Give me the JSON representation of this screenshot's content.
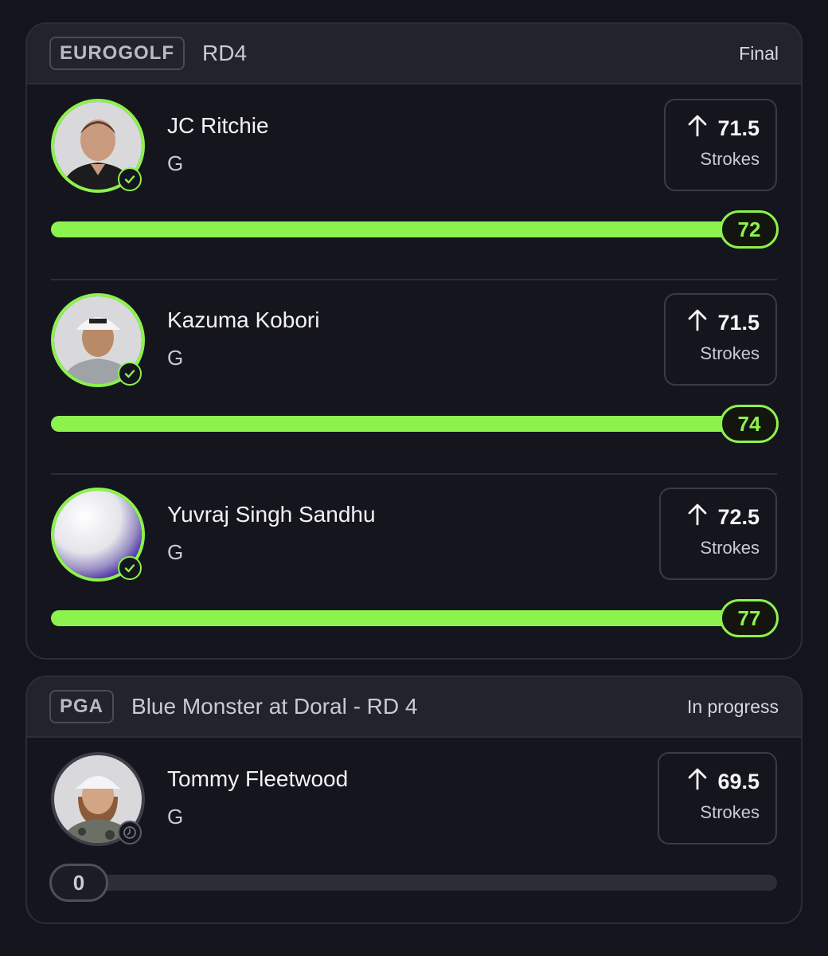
{
  "colors": {
    "accent": "#8cf24d",
    "background": "#14141c",
    "card": "#15151d"
  },
  "cards": [
    {
      "league": "EUROGOLF",
      "event": "RD4",
      "status": "Final",
      "players": [
        {
          "name": "JC Ritchie",
          "position": "G",
          "line": "71.5",
          "line_label": "Strokes",
          "direction": "up-arrow-icon",
          "score": "72",
          "progress": 1.0
        },
        {
          "name": "Kazuma Kobori",
          "position": "G",
          "line": "71.5",
          "line_label": "Strokes",
          "direction": "up-arrow-icon",
          "score": "74",
          "progress": 1.0
        },
        {
          "name": "Yuvraj Singh Sandhu",
          "position": "G",
          "line": "72.5",
          "line_label": "Strokes",
          "direction": "up-arrow-icon",
          "score": "77",
          "progress": 1.0
        }
      ]
    },
    {
      "league": "PGA",
      "event": "Blue Monster at Doral - RD 4",
      "status": "In progress",
      "players": [
        {
          "name": "Tommy Fleetwood",
          "position": "G",
          "line": "69.5",
          "line_label": "Strokes",
          "direction": "up-arrow-icon",
          "score": "0",
          "progress": 0.0
        }
      ]
    }
  ]
}
